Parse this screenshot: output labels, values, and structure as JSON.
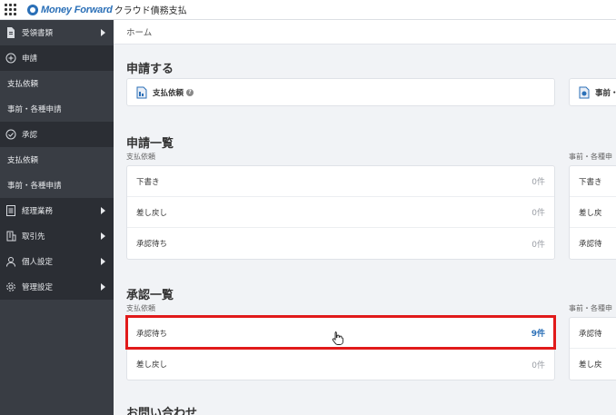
{
  "header": {
    "brand": "Money Forward",
    "product": "クラウド債務支払"
  },
  "sidebar": {
    "items": [
      {
        "label": "受領書類",
        "icon": "document-icon",
        "caret": true
      },
      {
        "label": "申請",
        "icon": "plus-circle-icon",
        "caret": false
      },
      {
        "label": "支払依頼",
        "sub": true
      },
      {
        "label": "事前・各種申請",
        "sub": true
      },
      {
        "label": "承認",
        "icon": "check-circle-icon",
        "caret": false
      },
      {
        "label": "支払依頼",
        "sub": true
      },
      {
        "label": "事前・各種申請",
        "sub": true
      },
      {
        "label": "経理業務",
        "icon": "ledger-icon",
        "caret": true
      },
      {
        "label": "取引先",
        "icon": "building-icon",
        "caret": true
      },
      {
        "label": "個人設定",
        "icon": "user-icon",
        "caret": true
      },
      {
        "label": "管理設定",
        "icon": "gear-icon",
        "caret": true
      }
    ]
  },
  "breadcrumb": "ホーム",
  "apply": {
    "title": "申請する",
    "cards": [
      {
        "label": "支払依頼",
        "help": "?"
      },
      {
        "label": "事前・"
      }
    ]
  },
  "apply_list": {
    "title": "申請一覧",
    "left_label": "支払依頼",
    "right_label": "事前・各種申",
    "rows": [
      {
        "label": "下書き",
        "count": "0件"
      },
      {
        "label": "差し戻し",
        "count": "0件"
      },
      {
        "label": "承認待ち",
        "count": "0件"
      }
    ],
    "right_rows": [
      "下書き",
      "差し戻",
      "承認待"
    ]
  },
  "approval_list": {
    "title": "承認一覧",
    "left_label": "支払依頼",
    "right_label": "事前・各種申",
    "rows": [
      {
        "label": "承認待ち",
        "count": "9件"
      },
      {
        "label": "差し戻し",
        "count": "0件"
      }
    ],
    "right_rows": [
      "承認待",
      "差し戻"
    ]
  },
  "contact": {
    "title": "お問い合わせ"
  },
  "colors": {
    "sidebar_bg": "#393d44",
    "brand_blue": "#2a6fb7",
    "highlight_red": "#e11a1a"
  }
}
